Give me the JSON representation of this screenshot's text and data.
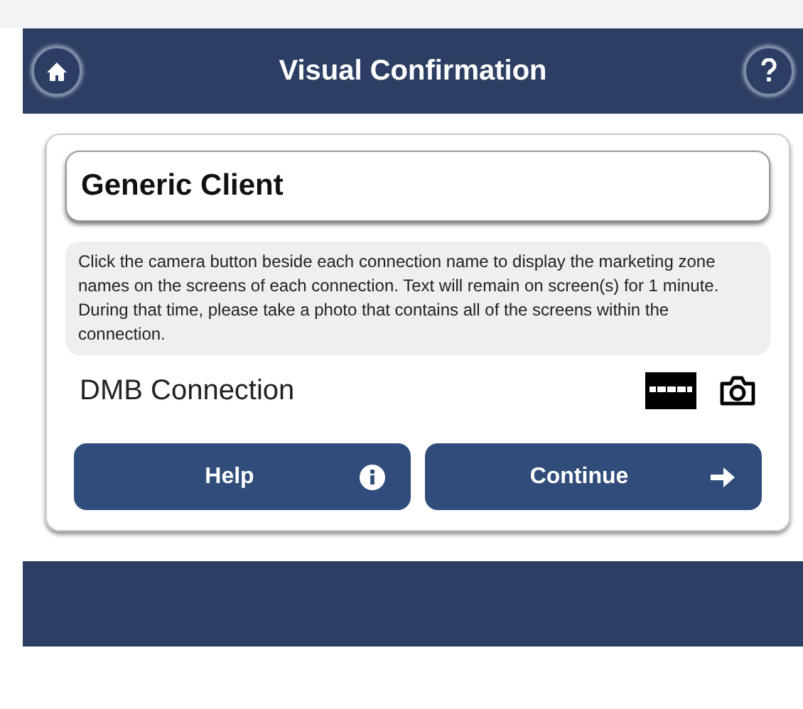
{
  "header": {
    "title": "Visual Confirmation"
  },
  "client": {
    "value": "Generic Client"
  },
  "instructions": "Click the camera button beside each connection name to display the marketing zone names on the screens of each connection. Text will remain on screen(s) for 1 minute. During that time, please take a photo that contains all of the screens within the connection.",
  "connections": [
    {
      "name": "DMB Connection"
    }
  ],
  "buttons": [
    {
      "label": "Help",
      "kind": "info"
    },
    {
      "label": "Continue",
      "kind": "next"
    }
  ]
}
